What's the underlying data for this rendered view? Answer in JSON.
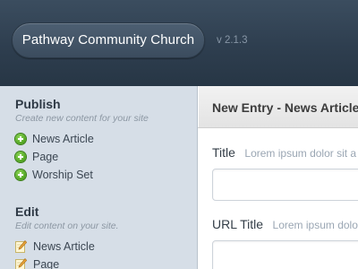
{
  "header": {
    "brand_name": "Pathway Community Church",
    "version": "v 2.1.3"
  },
  "sidebar": {
    "publish": {
      "heading": "Publish",
      "subtitle": "Create new content for your site",
      "icon": "plus-circle-icon",
      "items": [
        {
          "label": "News Article"
        },
        {
          "label": "Page"
        },
        {
          "label": "Worship Set"
        }
      ]
    },
    "edit": {
      "heading": "Edit",
      "subtitle": "Edit content on your site.",
      "icon": "pencil-note-icon",
      "items": [
        {
          "label": "News Article"
        },
        {
          "label": "Page"
        }
      ]
    }
  },
  "main": {
    "title": "New Entry - News Article",
    "fields": [
      {
        "label": "Title",
        "hint": "Lorem ipsum dolor sit a",
        "value": ""
      },
      {
        "label": "URL Title",
        "hint": "Lorem ipsum dolor sit",
        "value": ""
      }
    ]
  },
  "colors": {
    "header_bg": "#2e3e4f",
    "sidebar_bg": "#d6dee7",
    "accent_green": "#4ea21f",
    "text_dark": "#2f3a46"
  }
}
